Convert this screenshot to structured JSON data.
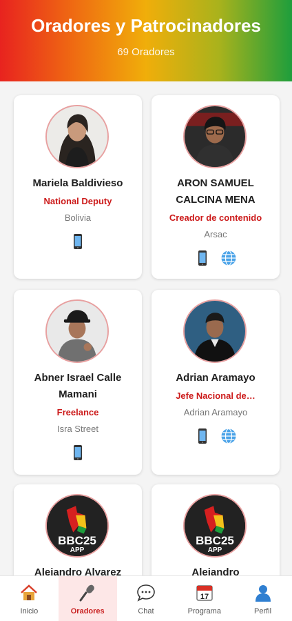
{
  "header": {
    "title": "Oradores y Patrocinadores",
    "count": "69 Oradores"
  },
  "speakers": [
    {
      "name": "Mariela Baldivieso",
      "role": "National Deputy",
      "org": "Bolivia",
      "icons": [
        "phone-icon"
      ]
    },
    {
      "name": "ARON SAMUEL CALCINA MENA",
      "role": "Creador de contenido",
      "org": "Arsac",
      "icons": [
        "phone-icon",
        "globe-icon"
      ]
    },
    {
      "name": "Abner Israel Calle Mamani",
      "role": "Freelance",
      "org": "Isra Street",
      "icons": [
        "phone-icon"
      ]
    },
    {
      "name": "Adrian Aramayo",
      "role": "Jefe Nacional de…",
      "org": "Adrian Aramayo",
      "icons": [
        "phone-icon",
        "globe-icon"
      ]
    },
    {
      "name": "Alejandro Alvarez",
      "role": "",
      "org": "",
      "icons": []
    },
    {
      "name": "Alejandro",
      "role": "",
      "org": "",
      "icons": []
    }
  ],
  "logo": {
    "text": "BBC25",
    "subtext": "APP"
  },
  "nav": [
    {
      "label": "Inicio",
      "icon": "home-icon"
    },
    {
      "label": "Oradores",
      "icon": "microphone-icon",
      "active": true
    },
    {
      "label": "Chat",
      "icon": "chat-icon"
    },
    {
      "label": "Programa",
      "icon": "calendar-icon",
      "badge": "17"
    },
    {
      "label": "Perfil",
      "icon": "profile-icon"
    }
  ],
  "colors": {
    "accent": "#c81e1e",
    "role": "#cc1a1a",
    "active_bg": "#fde7e7"
  }
}
